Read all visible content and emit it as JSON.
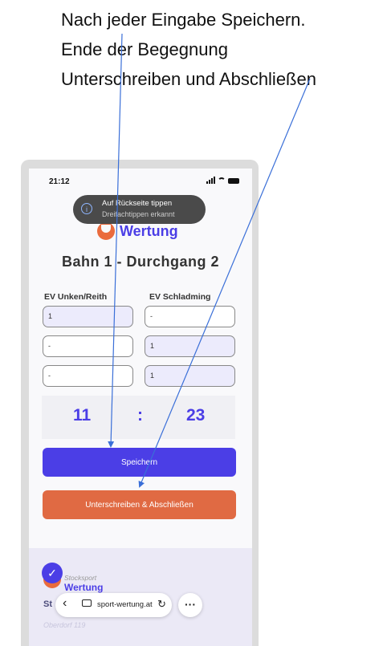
{
  "instructions": [
    "Nach jeder Eingabe Speichern.",
    "Ende der Begegnung",
    "Unterschreiben und Abschließen"
  ],
  "status_bar": {
    "time": "21:12"
  },
  "toast": {
    "title": "Auf Rückseite tippen",
    "subtitle": "Dreifachtippen erkannt",
    "icon": "info-icon"
  },
  "app": {
    "logo_text": "Wertung",
    "heading": "Bahn 1 - Durchgang 2",
    "team_left": "EV Unken/Reith",
    "team_right": "EV Schladming",
    "rows": [
      {
        "left": "1",
        "right": "-"
      },
      {
        "left": "-",
        "right": "1"
      },
      {
        "left": "-",
        "right": "1"
      }
    ],
    "total_left": "11",
    "total_separator": ":",
    "total_right": "23",
    "save_label": "Speichern",
    "sign_label": "Unterschreiben & Abschließen"
  },
  "footer": {
    "logo_small": "Stocksport",
    "logo_big": "Wertung",
    "text_prefix": "St",
    "address": "Oberdorf 119"
  },
  "browser": {
    "url": "sport-wertung.at",
    "back_icon": "chevron-left-icon",
    "reload_icon": "reload-icon",
    "more_icon": "more-icon"
  },
  "colors": {
    "primary": "#4b3ee6",
    "accent": "#e06a43",
    "arrow": "#3a6fd8"
  }
}
